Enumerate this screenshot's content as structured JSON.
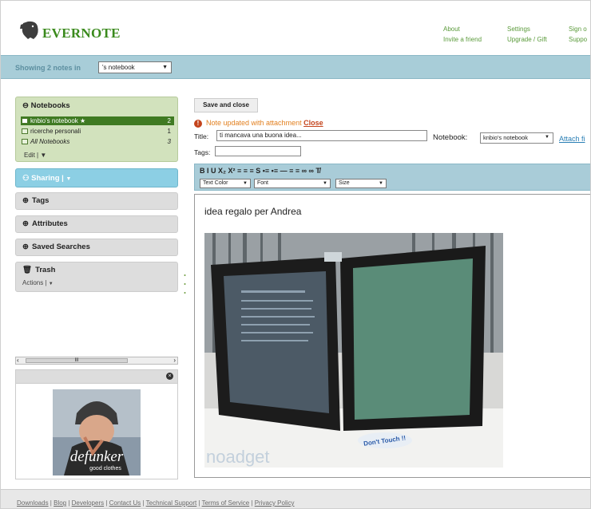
{
  "header": {
    "logo_text": "EVERNOTE",
    "links": {
      "about": "About",
      "settings": "Settings",
      "sign_out": "Sign o",
      "invite": "Invite a friend",
      "upgrade": "Upgrade / Gift",
      "support": "Suppo"
    }
  },
  "notebook_bar": {
    "showing": "Showing 2 notes in",
    "selected_notebook": "'s notebook"
  },
  "sidebar": {
    "notebooks_title": "Notebooks",
    "notebooks": [
      {
        "label": "knbio's notebook ★",
        "count": "2"
      },
      {
        "label": "ricerche personali",
        "count": "1"
      },
      {
        "label": "All Notebooks",
        "count": "3"
      }
    ],
    "edit": "Edit |",
    "sharing": "Sharing |",
    "tags": "Tags",
    "attributes": "Attributes",
    "saved_searches": "Saved Searches",
    "trash": "Trash",
    "actions": "Actions |",
    "scroll_thumb": "III",
    "ad_brand": "defunker",
    "ad_tagline": "good clothes"
  },
  "editor": {
    "save_close": "Save and close",
    "message": "Note updated with attachment",
    "message_close": "Close",
    "title_label": "Title:",
    "title_value": "ti mancava una buona idea...",
    "notebook_label": "Notebook:",
    "notebook_value": "knbio's notebook",
    "attach": "Attach fi",
    "tags_label": "Tags:",
    "toolbar_row": "B  I  U  X₂ X²  ≡  ≡  ≡  S  •≡  •≡  —  ≡  ≡  ∞  ∞  T̸",
    "text_color": "Text Color",
    "font": "Font",
    "size": "Size",
    "body_text": "idea regalo per Andrea",
    "photo_sticker": "Don't Touch !!",
    "photo_watermark": "noadget"
  },
  "footer": {
    "links": [
      "Downloads",
      "Blog",
      "Developers",
      "Contact Us",
      "Technical Support",
      "Terms of Service",
      "Privacy Policy"
    ]
  },
  "colors": {
    "brand_green": "#3a8a1c",
    "bar_blue": "#a8cdd8",
    "sharing_blue": "#8ccfe4",
    "notebook_panel": "#d2e2bd",
    "alert_orange": "#e28020"
  }
}
